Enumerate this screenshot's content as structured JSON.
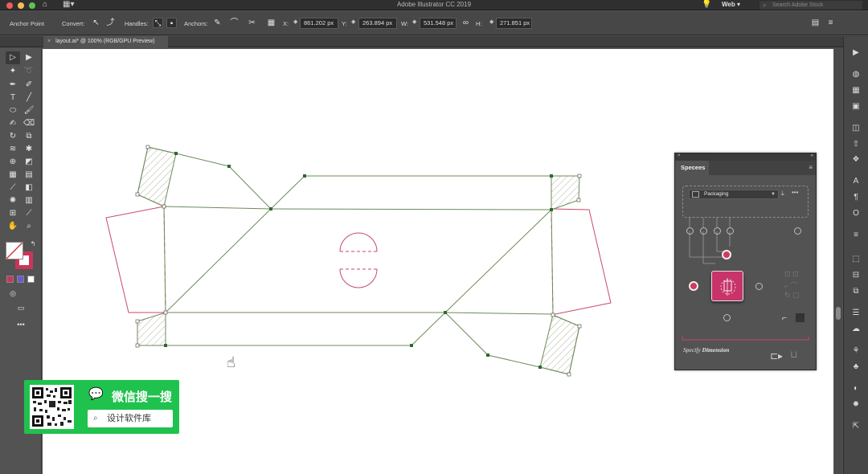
{
  "window": {
    "title": "Adobe Illustrator CC 2019",
    "workspace": "Web",
    "stock_search_placeholder": "Search Adobe Stock"
  },
  "control_bar": {
    "mode": "Anchor Point",
    "convert_label": "Convert:",
    "handles_label": "Handles:",
    "anchors_label": "Anchors:",
    "x_label": "X:",
    "x_value": "861.202 px",
    "y_label": "Y:",
    "y_value": "263.894 px",
    "w_label": "W:",
    "w_value": "531.548 px",
    "h_label": "H:",
    "h_value": "271.851 px"
  },
  "document_tab": {
    "label": "layout.ai* @ 100% (RGB/GPU Preview)"
  },
  "panel": {
    "title": "Specees",
    "preset": "Packaging",
    "footer_prefix": "Specify",
    "footer_bold": "Dimension"
  },
  "wechat": {
    "title": "微信搜一搜",
    "search_text": "设计软件库"
  },
  "colors": {
    "accent_pink": "#c8336a",
    "dieline_green": "#4b7a3a",
    "wechat_green": "#20c24e"
  },
  "icons": [
    "home-icon",
    "search-icon",
    "link-icon",
    "close-icon",
    "menu-icon",
    "cursor-hand-icon"
  ]
}
